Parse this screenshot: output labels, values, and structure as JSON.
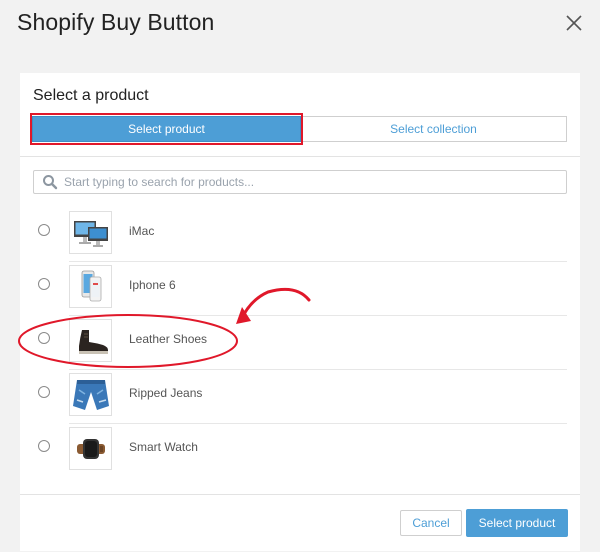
{
  "header": {
    "title": "Shopify Buy Button",
    "close_icon": "close-icon"
  },
  "panel": {
    "title": "Select a product",
    "tabs": [
      {
        "label": "Select product",
        "active": true
      },
      {
        "label": "Select collection",
        "active": false
      }
    ],
    "search": {
      "placeholder": "Start typing to search for products...",
      "value": "",
      "icon": "search-icon"
    },
    "products": [
      {
        "name": "iMac",
        "selected": false
      },
      {
        "name": "Iphone 6",
        "selected": false
      },
      {
        "name": "Leather Shoes",
        "selected": false
      },
      {
        "name": "Ripped Jeans",
        "selected": false
      },
      {
        "name": "Smart Watch",
        "selected": false
      }
    ]
  },
  "footer": {
    "cancel_label": "Cancel",
    "select_label": "Select product"
  },
  "colors": {
    "accent": "#4d9ed6",
    "annotation": "#e0182a",
    "background": "#f2f2f2"
  }
}
